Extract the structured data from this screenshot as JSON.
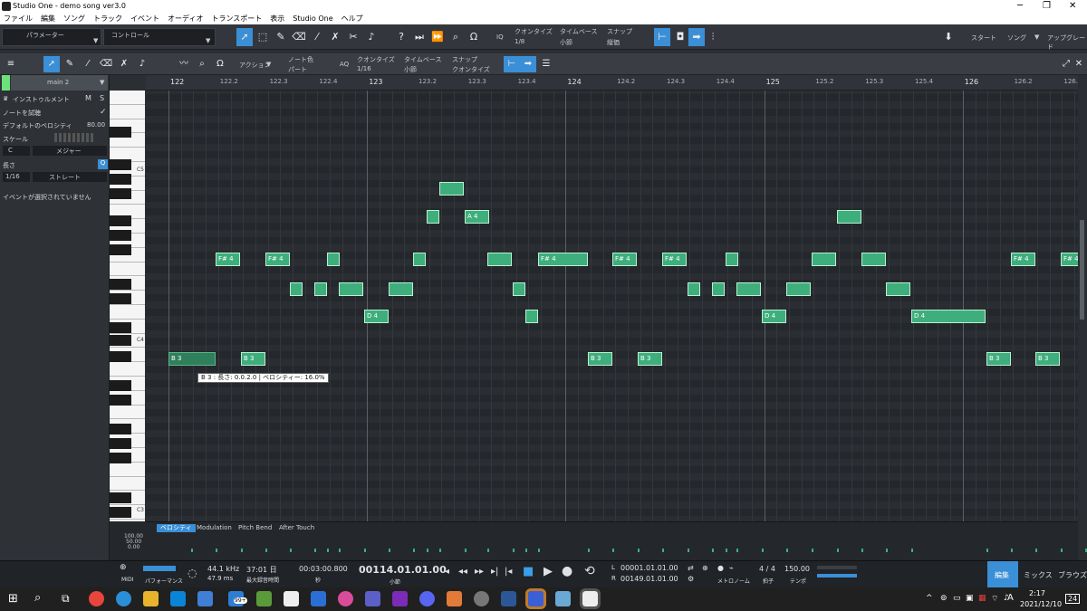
{
  "window": {
    "title": "Studio One - demo song ver3.0",
    "controls": [
      "─",
      "❐",
      "✕"
    ]
  },
  "menu": [
    "ファイル",
    "編集",
    "ソング",
    "トラック",
    "イベント",
    "オーディオ",
    "トランスポート",
    "表示",
    "Studio One",
    "ヘルプ"
  ],
  "toolbar": {
    "parameter": "パラメーター",
    "control": "コントロール",
    "iq": "IQ",
    "quantize_label": "クオンタイズ",
    "quantize_value": "1/8",
    "timebase_label": "タイムベース",
    "timebase_value": "小節",
    "snap_label": "スナップ",
    "snap_value": "縦価",
    "start": "スタート",
    "song": "ソング",
    "upgrade": "アップグレード"
  },
  "editor": {
    "action": "アクション",
    "note_color_label": "ノート色",
    "note_color_value": "パート",
    "aq": "AQ",
    "quantize_label": "クオンタイズ",
    "quantize_value": "1/16",
    "timebase_label": "タイムベース",
    "timebase_value": "小節",
    "snap_label": "スナップ",
    "snap_value": "クオンタイズ"
  },
  "inspector": {
    "track_name": "main 2",
    "instrument": "インストゥルメント",
    "m": "M",
    "s": "S",
    "audition": "ノートを試聴",
    "default_velocity_label": "デフォルトのベロシティ",
    "default_velocity": "80.00",
    "scale_label": "スケール",
    "scale_root": "C",
    "scale_type": "メジャー",
    "length_label": "長さ",
    "length_value": "1/16",
    "length_mode": "ストレート",
    "q": "Q",
    "no_event": "イベントが選択されていません"
  },
  "ruler": [
    "122",
    "122.2",
    "122.3",
    "122.4",
    "123",
    "123.2",
    "123.3",
    "123.4",
    "124",
    "124.2",
    "124.3",
    "124.4",
    "125",
    "125.2",
    "125.3",
    "125.4",
    "126",
    "126.2",
    "126."
  ],
  "piano_octaves": [
    "C5",
    "C4",
    "C3"
  ],
  "notes_labels": {
    "fs": "F# 4",
    "a": "A 4",
    "d": "D 4",
    "b": "B 3"
  },
  "tooltip": "B 3 : 長さ: 0.0.2.0 | ベロシティー: 16.0%",
  "auto_tabs": [
    "ベロシティ",
    "Modulation",
    "Pitch Bend",
    "After Touch"
  ],
  "auto_scale": [
    "100.00",
    "50.00",
    "0.00"
  ],
  "transport": {
    "midi": "MIDI",
    "perf": "パフォーマンス",
    "rate": "44.1 kHz",
    "latency": "47.9 ms",
    "rec_time": "37:01 日",
    "rec_label": "最大録音時間",
    "time": "00:03:00.800",
    "sec": "秒",
    "position": "00114.01.01.00",
    "bar_unit": "小節",
    "loop_l": "00001.01.01.00",
    "loop_r": "00149.01.01.00",
    "metronome": "メトロノーム",
    "timesig": "4 / 4",
    "timesig_label": "拍子",
    "tempo": "150.00",
    "tempo_label": "テンポ",
    "edit": "編集",
    "mix": "ミックス",
    "browse": "ブラウズ",
    "l": "L",
    "r": "R"
  },
  "taskbar": {
    "time": "2:17",
    "date": "2021/12/10",
    "badge": "99+",
    "ime": "A",
    "notif": "24"
  },
  "colors": {
    "note": "#3fae7d",
    "accent": "#3a8fd6",
    "track_color": "#6ce07a"
  }
}
